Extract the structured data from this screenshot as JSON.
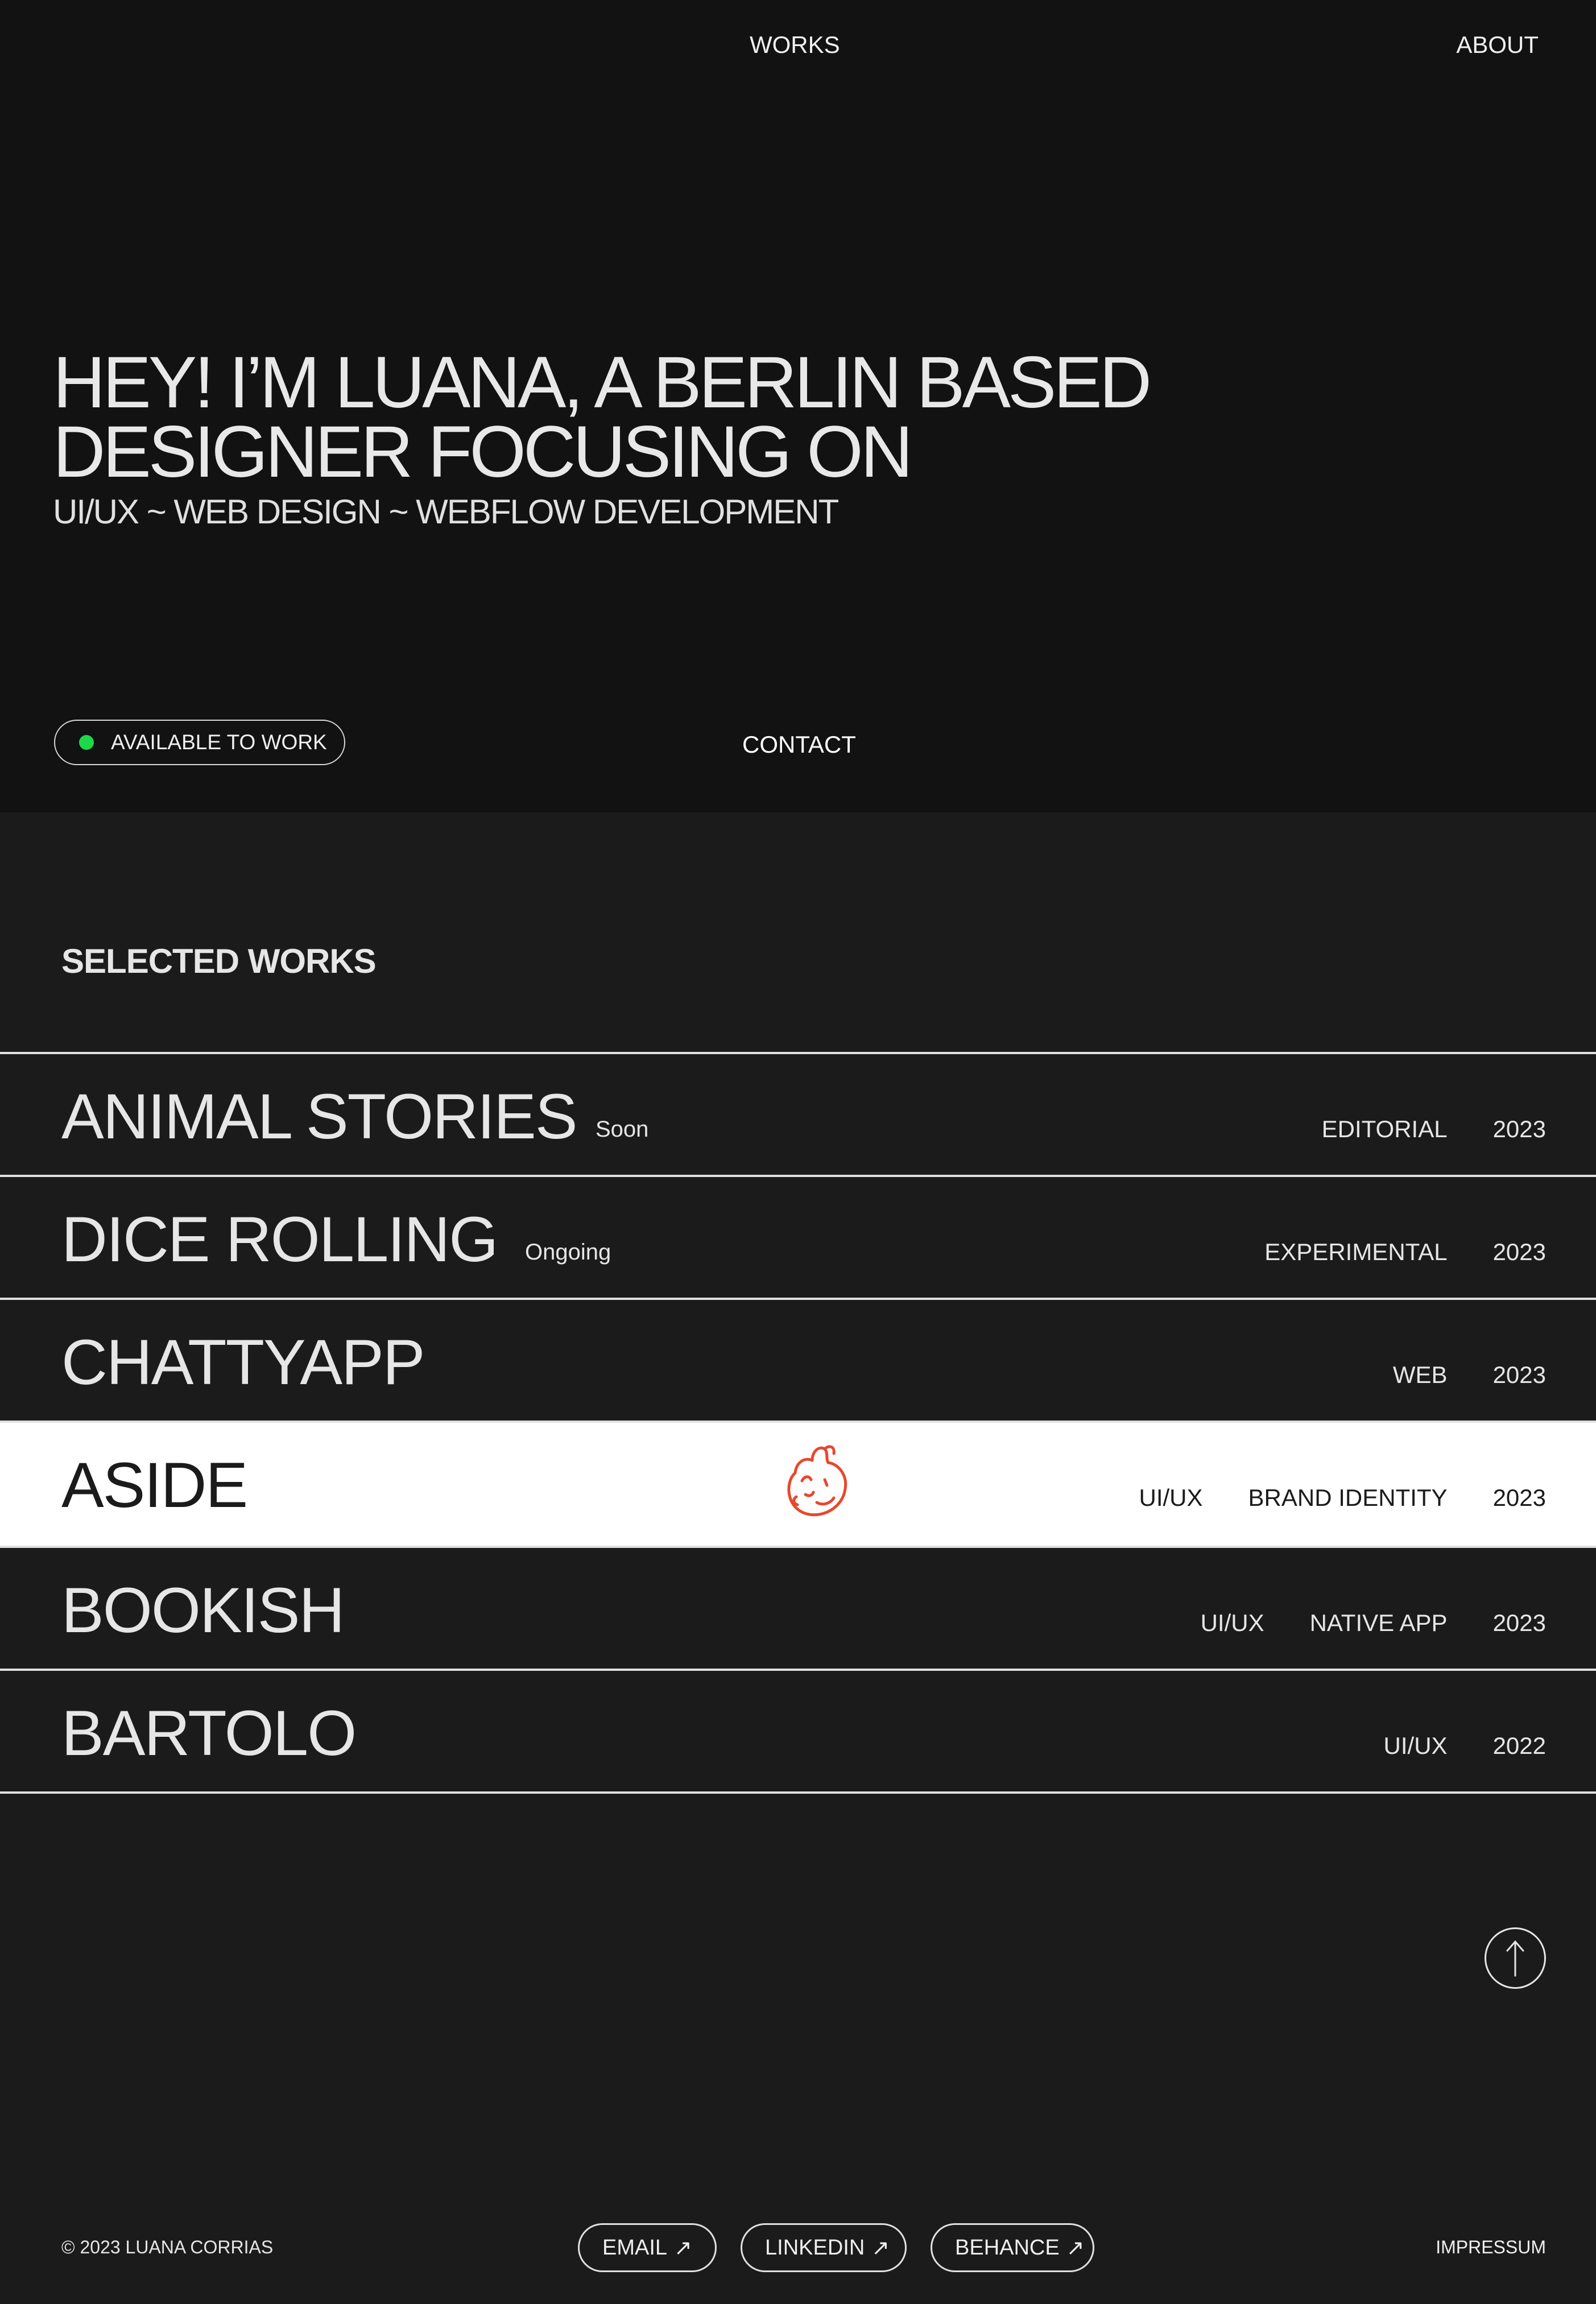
{
  "nav": {
    "works": "WORKS",
    "about": "ABOUT"
  },
  "hero": {
    "title_line1": "HEY! I’M LUANA, A BERLIN BASED",
    "title_line2": "DESIGNER FOCUSING ON",
    "subtitle": "UI/UX ~ WEB DESIGN ~ WEBFLOW DEVELOPMENT",
    "available": "AVAILABLE TO WORK",
    "available_color": "#1ed84a",
    "contact": "CONTACT"
  },
  "works": {
    "title": "SELECTED WORKS",
    "items": [
      {
        "name": "ANIMAL STORIES",
        "status": "Soon",
        "tags": [
          "EDITORIAL",
          "2023"
        ]
      },
      {
        "name": "DICE ROLLING",
        "status": "Ongoing",
        "tags": [
          "EXPERIMENTAL",
          "2023"
        ]
      },
      {
        "name": "CHATTYAPP",
        "status": "",
        "tags": [
          "WEB",
          "2023"
        ]
      },
      {
        "name": "ASIDE",
        "status": "",
        "tags": [
          "UI/UX",
          "BRAND IDENTITY",
          "2023"
        ]
      },
      {
        "name": "BOOKISH",
        "status": "",
        "tags": [
          "UI/UX",
          "NATIVE APP",
          "2023"
        ]
      },
      {
        "name": "BARTOLO",
        "status": "",
        "tags": [
          "UI/UX",
          "2022"
        ]
      }
    ],
    "active_index": 3,
    "hover_icon": "smiling-face-doodle-icon",
    "hover_icon_color": "#e8472e"
  },
  "scroll_top_icon": "arrow-up-icon",
  "footer": {
    "copyright": "© 2023 LUANA CORRIAS",
    "links": [
      {
        "label": "EMAIL",
        "icon": "arrow-up-right-icon"
      },
      {
        "label": "LINKEDIN",
        "icon": "arrow-up-right-icon"
      },
      {
        "label": "BEHANCE",
        "icon": "arrow-up-right-icon"
      }
    ],
    "impressum": "IMPRESSUM"
  }
}
